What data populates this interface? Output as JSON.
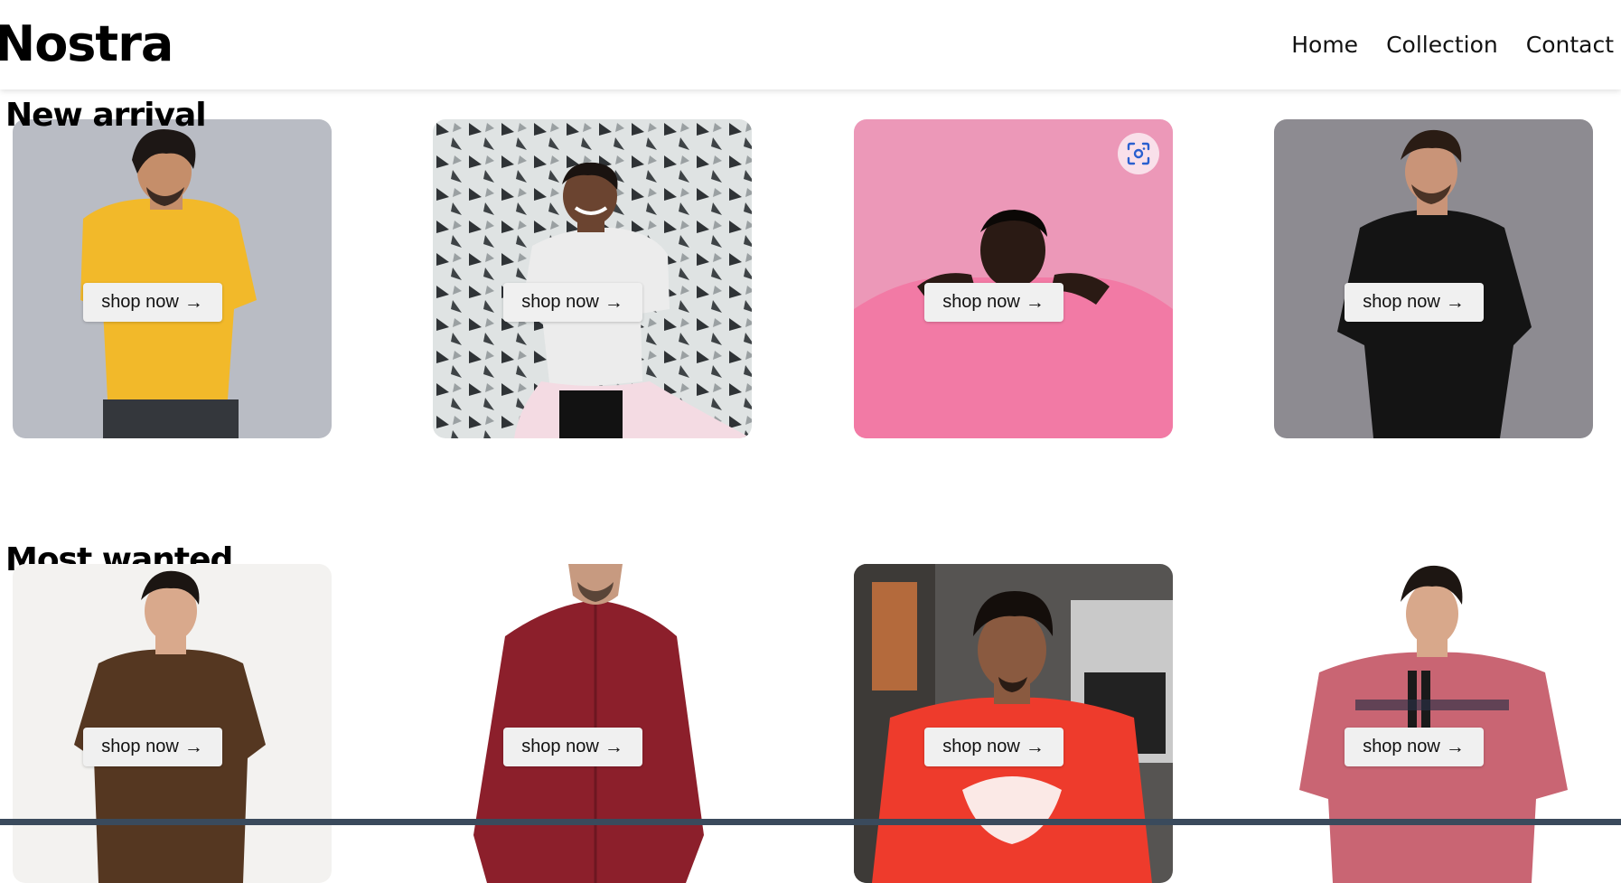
{
  "brand": {
    "logo": "Nostra"
  },
  "nav": {
    "items": [
      "Home",
      "Collection",
      "Contact"
    ]
  },
  "sections": {
    "new_arrival": {
      "title": "New arrival",
      "cards": [
        {
          "button": "shop now",
          "shirt_color": "#f2b92a",
          "bg": "#b9bcc4"
        },
        {
          "button": "shop now",
          "shirt_color": "#e8e8e8",
          "bg": "#dfe3e3"
        },
        {
          "button": "shop now",
          "shirt_color": "#f27aa5",
          "bg": "#ec98b8"
        },
        {
          "button": "shop now",
          "shirt_color": "#141414",
          "bg": "#8d8b91"
        }
      ]
    },
    "most_wanted": {
      "title": "Most wanted",
      "cards": [
        {
          "button": "shop now",
          "shirt_color": "#553721",
          "bg": "#f3f2f0"
        },
        {
          "button": "shop now",
          "shirt_color": "#8c1f2b",
          "bg": "#ffffff"
        },
        {
          "button": "shop now",
          "shirt_color": "#ee3b2c",
          "bg": "#565452"
        },
        {
          "button": "shop now",
          "shirt_color": "#c96573",
          "bg": "#ffffff"
        }
      ]
    }
  },
  "icons": {
    "button_arrow": "arrow-right-icon",
    "image_search": "lens-search-icon"
  }
}
